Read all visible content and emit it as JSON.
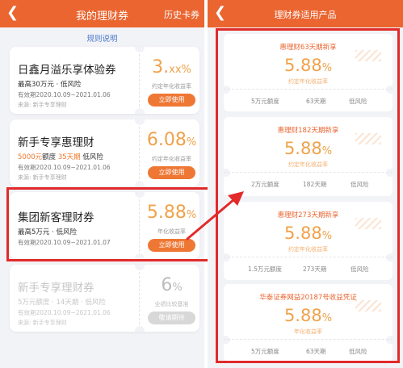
{
  "left": {
    "header": {
      "back_icon": "chevron-left-icon",
      "title": "我的理财券",
      "history_label": "历史卡券"
    },
    "rules_link": "规则说明",
    "coupons": [
      {
        "name": "日鑫月溢乐享体验券",
        "line1": [
          {
            "text": "最高30万元 · 低风险",
            "accent": true
          }
        ],
        "line2": "有效期2020.10.09~2021.01.06",
        "line3": "来源: 新手专享理财",
        "rate_main": "3.",
        "rate_suffix": "xx%",
        "rate_label": "约定年化收益率",
        "button": "立即使用",
        "disabled": false
      },
      {
        "name": "新手专享惠理财",
        "line1": [
          {
            "text": "5000元",
            "accent": true
          },
          {
            "text": "额度 ",
            "accent": false
          },
          {
            "text": "35天期",
            "accent": true
          },
          {
            "text": " 低风险",
            "accent": false
          }
        ],
        "line2": "有效期2020.10.09~2021.01.06",
        "line3": "来源: 新手专享理财",
        "rate_main": "6.08",
        "rate_suffix": "%",
        "rate_label": "约定年化收益率",
        "button": "立即使用",
        "disabled": false
      },
      {
        "name": "集团新客理财券",
        "line1": [
          {
            "text": "最高5万元 · 低风险",
            "accent": true
          }
        ],
        "line2": "有效期2020.10.09~2021.01.07",
        "line3": "",
        "rate_main": "5.88",
        "rate_suffix": "%",
        "rate_label": "年化收益率",
        "button": "立即使用",
        "disabled": false
      },
      {
        "name": "新手专享理财券",
        "line1": [
          {
            "text": "5万元额度 · 14天期 · 低风险",
            "accent": false
          }
        ],
        "line2": "有效期2020.10.09~2021.01.06",
        "line3": "来源: 新手专享理财",
        "rate_main": "6",
        "rate_suffix": "%",
        "rate_label": "业绩比较基准",
        "button": "敬请期待",
        "disabled": true
      }
    ]
  },
  "right": {
    "header": {
      "back_icon": "chevron-left-icon",
      "title": "理财券适用产品"
    },
    "products": [
      {
        "name": "惠理财63天期新享",
        "rate_main": "5.88",
        "rate_suffix": "%",
        "rate_label": "约定年化收益率",
        "amount": "5万元额度",
        "term": "63天期",
        "risk": "低风险"
      },
      {
        "name": "惠理财182天期新享",
        "rate_main": "5.88",
        "rate_suffix": "%",
        "rate_label": "约定年化收益率",
        "amount": "2万元额度",
        "term": "182天期",
        "risk": "低风险"
      },
      {
        "name": "惠理财273天期新享",
        "rate_main": "5.88",
        "rate_suffix": "%",
        "rate_label": "约定年化收益率",
        "amount": "1.5万元额度",
        "term": "273天期",
        "risk": "低风险"
      },
      {
        "name": "华泰证券网益20187号收益凭证",
        "rate_main": "5.88",
        "rate_suffix": "%",
        "rate_label": "年化收益率",
        "amount": "5万元额度",
        "term": "63天期",
        "risk": "低风险"
      }
    ]
  },
  "colors": {
    "header": "#ea6530",
    "accent": "#ef7a30",
    "rate": "#f0a24a",
    "highlight": "#e22a2a",
    "link": "#4b78c9"
  }
}
